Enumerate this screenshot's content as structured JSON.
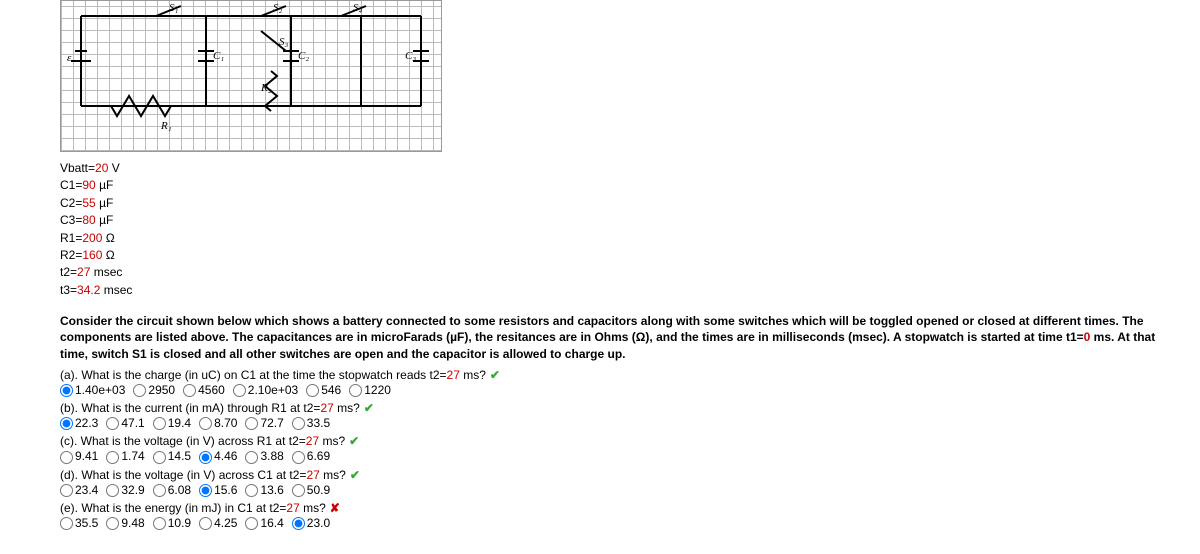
{
  "given": [
    {
      "label": "Vbatt",
      "value": "20",
      "unit": "V"
    },
    {
      "label": "C1",
      "value": "90",
      "unit": "µF"
    },
    {
      "label": "C2",
      "value": "55",
      "unit": "µF"
    },
    {
      "label": "C3",
      "value": "80",
      "unit": "µF"
    },
    {
      "label": "R1",
      "value": "200",
      "unit": "Ω"
    },
    {
      "label": "R2",
      "value": "160",
      "unit": "Ω"
    },
    {
      "label": "t2",
      "value": "27",
      "unit": "msec"
    },
    {
      "label": "t3",
      "value": "34.2",
      "unit": "msec"
    }
  ],
  "paragraph": {
    "pre": "Consider the circuit shown below which shows a battery connected to some resistors and capacitors along with some switches which will be toggled opened or closed at different times. The components are listed above. The capacitances are in microFarads (µF), the resitances are in Ohms (Ω), and the times are in milliseconds (msec). A stopwatch is started at time t1=",
    "t1": "0",
    "mid": " ms. At that time, switch S1 is closed and all other switches are open and the capacitor is allowed to charge up."
  },
  "parts": [
    {
      "id": "a",
      "q_pre": "(a). What is the charge (in uC) on C1 at the time the stopwatch reads t2=",
      "q_val": "27",
      "q_post": " ms?",
      "status": "correct",
      "options": [
        "1.40e+03",
        "2950",
        "4560",
        "2.10e+03",
        "546",
        "1220"
      ],
      "selected": 0
    },
    {
      "id": "b",
      "q_pre": "(b). What is the current (in mA) through R1 at t2=",
      "q_val": "27",
      "q_post": " ms?",
      "status": "correct",
      "options": [
        "22.3",
        "47.1",
        "19.4",
        "8.70",
        "72.7",
        "33.5"
      ],
      "selected": 0
    },
    {
      "id": "c",
      "q_pre": "(c). What is the voltage (in V) across R1 at t2=",
      "q_val": "27",
      "q_post": " ms?",
      "status": "correct",
      "options": [
        "9.41",
        "1.74",
        "14.5",
        "4.46",
        "3.88",
        "6.69"
      ],
      "selected": 3
    },
    {
      "id": "d",
      "q_pre": "(d). What is the voltage (in V) across C1 at t2=",
      "q_val": "27",
      "q_post": " ms?",
      "status": "correct",
      "options": [
        "23.4",
        "32.9",
        "6.08",
        "15.6",
        "13.6",
        "50.9"
      ],
      "selected": 3
    },
    {
      "id": "e",
      "q_pre": "(e). What is the energy (in mJ) in C1 at t2=",
      "q_val": "27",
      "q_post": " ms?",
      "status": "wrong",
      "options": [
        "35.5",
        "9.48",
        "10.9",
        "4.25",
        "16.4",
        "23.0"
      ],
      "selected": 5
    }
  ],
  "diagram_labels": {
    "s1": "S₁",
    "s2": "S₂",
    "s3": "S₃",
    "s4": "S₄",
    "e": "ε",
    "c1": "C₁",
    "c2": "C₂",
    "c3": "C₃",
    "r1": "R₁",
    "r2": "R₂"
  }
}
